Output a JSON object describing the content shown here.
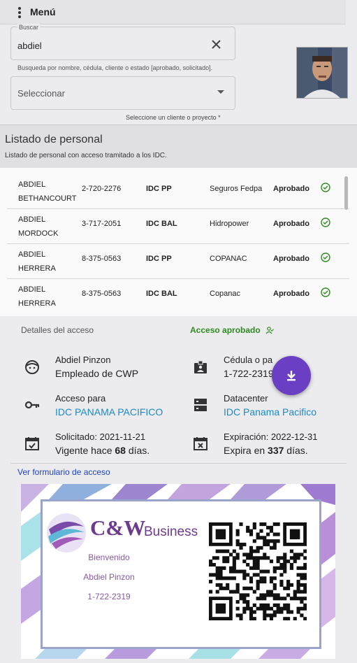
{
  "header": {
    "menu_label": "Menú"
  },
  "search": {
    "label": "Buscar",
    "value": "abdiel",
    "hint": "Busqueda por nombre, cédula, cliente o estado [aprobado, solicitado]."
  },
  "select": {
    "value": "Seleccionar",
    "hint": "Seleccione un cliente o proyecto *"
  },
  "list": {
    "title": "Listado de personal",
    "subtitle": "Listado de personal con acceso tramitado a los IDC.",
    "rows": [
      {
        "name1": "ABDIEL",
        "name2": "BETHANCOURT",
        "cedula": "2-720-2276",
        "idc": "IDC PP",
        "client": "Seguros Fedpa",
        "status": "Aprobado"
      },
      {
        "name1": "ABDIEL",
        "name2": "MORDOCK",
        "cedula": "3-717-2051",
        "idc": "IDC BAL",
        "client": "Hidropower",
        "status": "Aprobado"
      },
      {
        "name1": "ABDIEL",
        "name2": "HERRERA",
        "cedula": "8-375-0563",
        "idc": "IDC PP",
        "client": "COPANAC",
        "status": "Aprobado"
      },
      {
        "name1": "ABDIEL",
        "name2": "HERRERA",
        "cedula": "8-375-0563",
        "idc": "IDC BAL",
        "client": "Copanac",
        "status": "Aprobado"
      }
    ]
  },
  "details": {
    "title": "Detalles del acceso",
    "approved_label": "Acceso aprobado",
    "person_name": "Abdiel Pinzon",
    "person_role": "Empleado de CWP",
    "cedula_label": "Cédula o pasaporte",
    "cedula_value": "1-722-2319",
    "access_label": "Acceso para",
    "access_value": "IDC PANAMA PACIFICO",
    "datacenter_label": "Datacenter",
    "datacenter_value": "IDC Panama Pacifico",
    "requested_label": "Solicitado: 2021-11-21",
    "valid_prefix": "Vigente hace ",
    "valid_days": "68",
    "valid_suffix": " días.",
    "expiration_label": "Expiración: 2022-12-31",
    "expires_prefix": "Expira en ",
    "expires_days": "337",
    "expires_suffix": " días.",
    "form_link": "Ver formulario de acceso"
  },
  "card": {
    "brand_main": "C&W",
    "brand_sub": "Business",
    "welcome": "Bienvenido",
    "name": "Abdiel Pinzon",
    "id": "1-722-2319"
  },
  "colors": {
    "accent": "#6a3fc4",
    "approved": "#2e8b1f",
    "link": "#1e88c8",
    "brand": "#6d3a8e"
  }
}
